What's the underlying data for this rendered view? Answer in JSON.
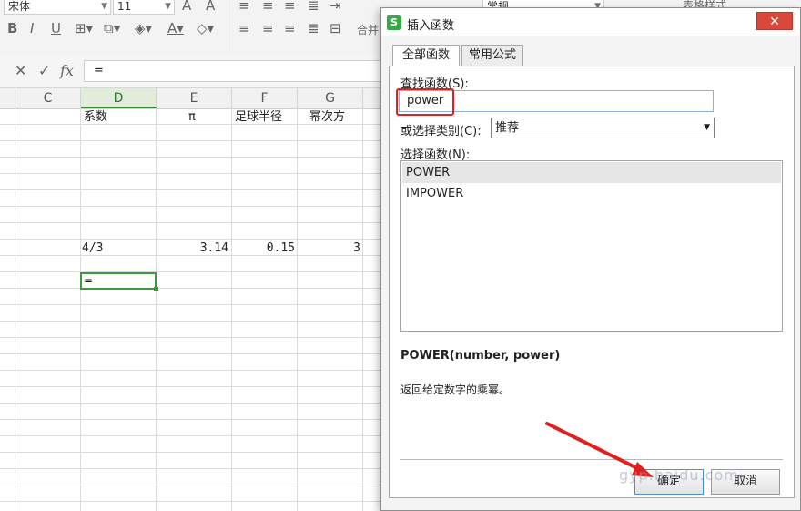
{
  "ribbon": {
    "font_name": "宋体",
    "font_size": "11",
    "number_format": "常规",
    "merge_label": "合并",
    "table_style_label": "表格样式"
  },
  "formula_bar": {
    "formula": "="
  },
  "sheet": {
    "columns": [
      "C",
      "D",
      "E",
      "F",
      "G"
    ],
    "selected_column": "D",
    "headers": {
      "d": "系数",
      "e": "π",
      "f": "足球半径",
      "g": "幂次方"
    },
    "values": {
      "d": "4/3",
      "e": "3.14",
      "f": "0.15",
      "g": "3"
    },
    "active_cell_value": "="
  },
  "dialog": {
    "title": "插入函数",
    "tabs": [
      "全部函数",
      "常用公式"
    ],
    "search_label": "查找函数(S):",
    "search_value": "power",
    "category_label": "或选择类别(C):",
    "category_value": "推荐",
    "function_label": "选择函数(N):",
    "functions": [
      "POWER",
      "IMPOWER"
    ],
    "selected_function": "POWER",
    "signature": "POWER(number, power)",
    "description": "返回给定数字的乘幂。",
    "ok_label": "确定",
    "cancel_label": "取消",
    "close_glyph": "✕"
  },
  "watermark": "gyp.baidu.com",
  "colors": {
    "accent_green": "#3c9a3c",
    "highlight_red": "#e02020",
    "close_red": "#d9483b"
  }
}
